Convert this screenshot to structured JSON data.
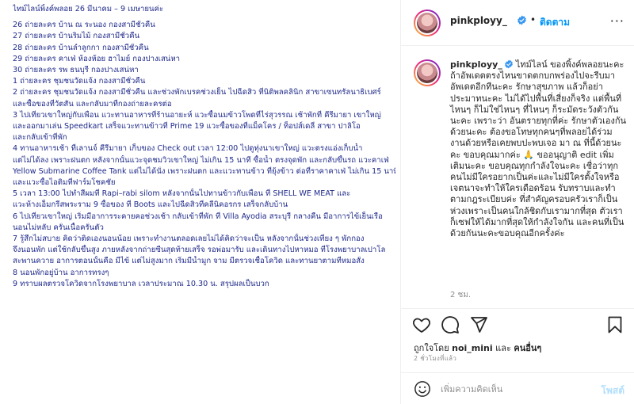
{
  "timeline": {
    "lines": [
      "ไทม์ไลน์พิ้งค์พลอย 26 มีนาคม – 9 เมษายนค่ะ",
      "26 ถ่ายละคร บ้าน ณ ระนอง กองสามีชั่วคืน",
      "27 ถ่ายละคร บ้านริมไม้ กองสามีชั่วคืน",
      "28 ถ่ายละคร บ้านลำลูกกา กองสามีชั่วคืน",
      "29 ถ่ายละคร คาเฟ่ ห้องห้อย ฮาไมย์ กองปางเสน่หา",
      "30 ถ่ายละคร รพ ธนบุรี กองปางเสน่หา",
      "1 ถ่ายละคร ชุมชนวัดแจ้ง กองสามีชั่วคืน",
      "2 ถ่ายละคร ชุมชนวัดแจ้ง กองสามีชั่วคืน และช่วงพักเบรคช่วงเย็น ไปฉีดสิว ที่นิติพลคลินิก สาขาเซนทรัลนาธิเบศร์",
      "และซื้อของที่วัตสัน และกลับมาที่กองถ่ายละครต่อ",
      "3 ไปเที่ยวเขาใหญ่กับเพื่อน แวะทานอาหารที่ร้านอายะห์ แวะซื้อนมข้าวโพดที่ไร่สุวรรณ เช้าพักที่ คีรีมายา เขาใหญ่",
      "และออกมาเล่น Speedkart เสร็จแวะทานข้าวที่ Prime 19 แวะซื้อของที่แม็คโคร / ท็อปส์เดลี่ สาขา ปาลิโอ",
      "และกลับเข้าที่พัก",
      "4 ทานอาหารเช้า ที่เลานจ์ คีรีมายา เก็บของ Check out เวลา 12:00 ไปดูทุ่งนาเขาใหญ่ แวะตรงแอ่งเก็บน้ำ",
      "แต่ไม่ได้ลง เพราะฝนตก หลังจากนั้นแวะจุดชมวิวเขาใหญ่ ไม่เกิน 15 นาที ซื้อน้ำ ตรงจุดพัก และกลับขึ้นรถ แวะคาเฟ่",
      "Yellow Submarine Coffee Tank แต่ไม่ได้นั่ง เพราะฝนตก และแวะทานข้าว ที่ยุ้งข้าว ต่อที่ราคาคาเฟ่ ไม่เกิน 15 นาที",
      "และแวะซื้อไอติมที่ฟาร์มโชคชัย",
      "5 เวลา 13:00 ไปทำสีผมที่ Rapi–rabi silom หลังจากนั้นไปทานข้าวกับเพื่อน ที่ SHELL WE MEAT และ",
      "แวะห้างเอ็มกรีสพระราม 9 ซื้อของ ที่ Boots และไปฉีดสิวที่คลีนิคอรกร เสร็จกลับบ้าน",
      "6 ไปเที่ยวเขาใหญ่ เริ่มมีอาการระคายคอช่วงเช้า กลับเข้าที่พัก ที่ Villa Ayodia สระบุรี กลางคืน มีอาการไข้เย็นเรือ",
      "นอนไม่หลับ ครั่นเนื้อครั่นตัว",
      "7 รู้สึกไม่สบาย คิดว่าติดเองนอนน้อย เพราะทำงานตลอดเลยไม่ได้คิดว่าจะเป็น หลังจากนั้นช่วงเที่ยง ๆ พักกอง",
      "จึงนอนพัก แต่ใช้กลับขึ้นสูง ภายหลังจากถ่ายซีนสุดท้ายเสร็จ รอพ่อมารับ และเดินทางไปหาหมอ ที่โรงพยาบาลเปาโล",
      "สะพานควาย อาการตอนนั้นคือ มีไข้ แต่ไม่สูงมาก เริ่มมีน้ำมูก จาม มีตรวจเชื้อโควิด และทานยาตามที่หมอสั่ง",
      "8 นอนพักอยู่บ้าน อาการทรงๆ",
      "9 ทราบผลตรวจโควิดจากโรงพยาบาล เวลาประมาณ 10.30 น. สรุปผลเป็นบวก"
    ]
  },
  "post": {
    "username": "pinkployy_",
    "dot": "•",
    "follow_label": "ติดตาม",
    "more_icon": "···",
    "caption": "ไทม์ไลน์ ของพิ้งค์พลอยนะคะ ถ้าอัพเดตตรงไหนขาดตกบกพร่องไปจะรีบมา อัพเดตอีกทีนะคะ รักษาสุขภาพ แล้วก็อย่าประมาทนะคะ ไม่ได้ไปพื้นที่เสี่ยงก็จริง แต่พื้นที่ไหนๆ ก็ไม่ใช่ไหนๆ ที่ไหนๆ ก็ระมัดระวังตัวกันนะคะ เพราะว่า อันตรายทุกที่ค่ะ รักษาตัวเองกันด้วยนะคะ ต้องขอโทษทุกคนๆที่พลอยได้ร่วมงานด้วยหรือเคยพบปะพบเจอ มา ณ ที่นี้ด้วยนะคะ ขอบคุณมากค่ะ 🙏 ขออนุญาติ edit เพิ่มเติมนะคะ ขอบคุณทุกกำลังใจนะคะ เชื่อว่าทุกคนไม่มีใครอยากเป็นค่ะและไม่มีใครตั้งใจหรือเจตนาจะทำให้ใครเดือดร้อน รับทราบและทำตามกฎระเบียบค่ะ ที่สำคัญครอบครัวเราก็เป็นห่วงเพราะเป็นคนใกล้ชิดกับเรามากที่สุด ตัวเราก็เซฟให้ได้มากที่สุดให้กำลังใจกัน และคนที่เป็นด้วยกันนะคะขอบคุณอีกครั้งค่ะ",
    "caption_time": "2 ชม.",
    "likes_prefix": "ถูกใจโดย",
    "likes_user": "noi_mini",
    "likes_conj": "และ",
    "likes_others": "คนอื่นๆ",
    "date": "2 ชั่วโมงที่แล้ว",
    "comment_placeholder": "เพิ่มความคิดเห็น",
    "post_label": "โพสต์"
  },
  "colors": {
    "accent": "#0095f6",
    "timeline_text": "#1f2a8a",
    "post_disabled": "#b2dffc"
  },
  "icons": [
    "verified-badge-icon",
    "more-options-icon",
    "heart-icon",
    "comment-icon",
    "share-icon",
    "bookmark-icon",
    "emoji-icon"
  ]
}
